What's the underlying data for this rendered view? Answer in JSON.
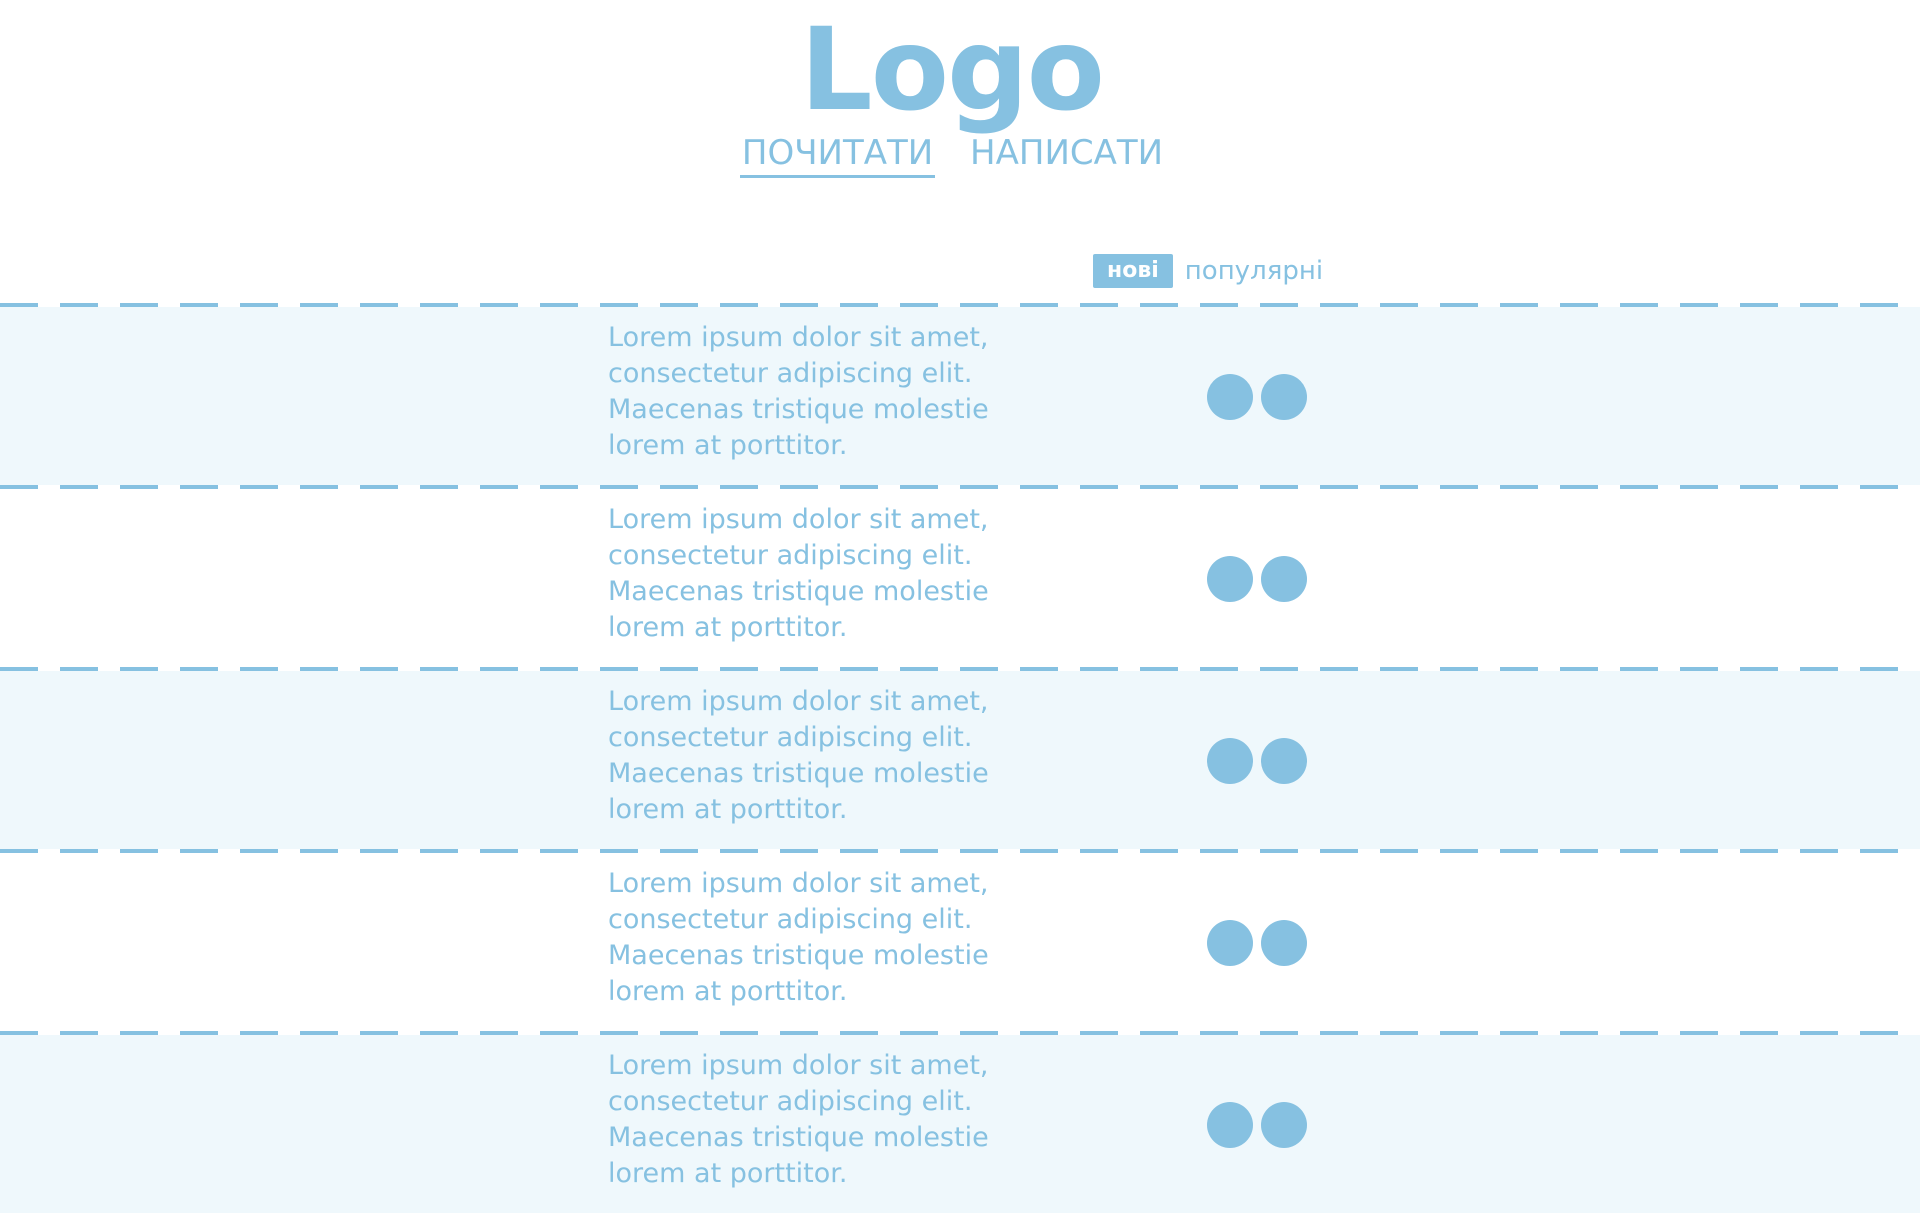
{
  "header": {
    "logo": "Logo",
    "nav": [
      {
        "label": "ПОЧИТАТИ",
        "active": true
      },
      {
        "label": "НАПИСАТИ",
        "active": false
      }
    ]
  },
  "filters": {
    "new_label": "нові",
    "popular_label": "популярні"
  },
  "posts": [
    {
      "text": "Lorem ipsum dolor sit amet, consectetur adipiscing elit. Maecenas tristique molestie lorem at porttitor.",
      "shaded": true
    },
    {
      "text": "Lorem ipsum dolor sit amet, consectetur adipiscing elit. Maecenas tristique molestie lorem at porttitor.",
      "shaded": false
    },
    {
      "text": "Lorem ipsum dolor sit amet, consectetur adipiscing elit. Maecenas tristique molestie lorem at porttitor.",
      "shaded": true
    },
    {
      "text": "Lorem ipsum dolor sit amet, consectetur adipiscing elit. Maecenas tristique molestie lorem at porttitor.",
      "shaded": false
    },
    {
      "text": "Lorem ipsum dolor sit amet, consectetur adipiscing elit. Maecenas tristique molestie lorem at porttitor.",
      "shaded": true
    }
  ],
  "icons": {
    "post_action_left": "circle-icon",
    "post_action_right": "circle-icon"
  },
  "colors": {
    "accent": "#86c1e1",
    "row_shade": "#eff8fc",
    "background": "#ffffff"
  }
}
